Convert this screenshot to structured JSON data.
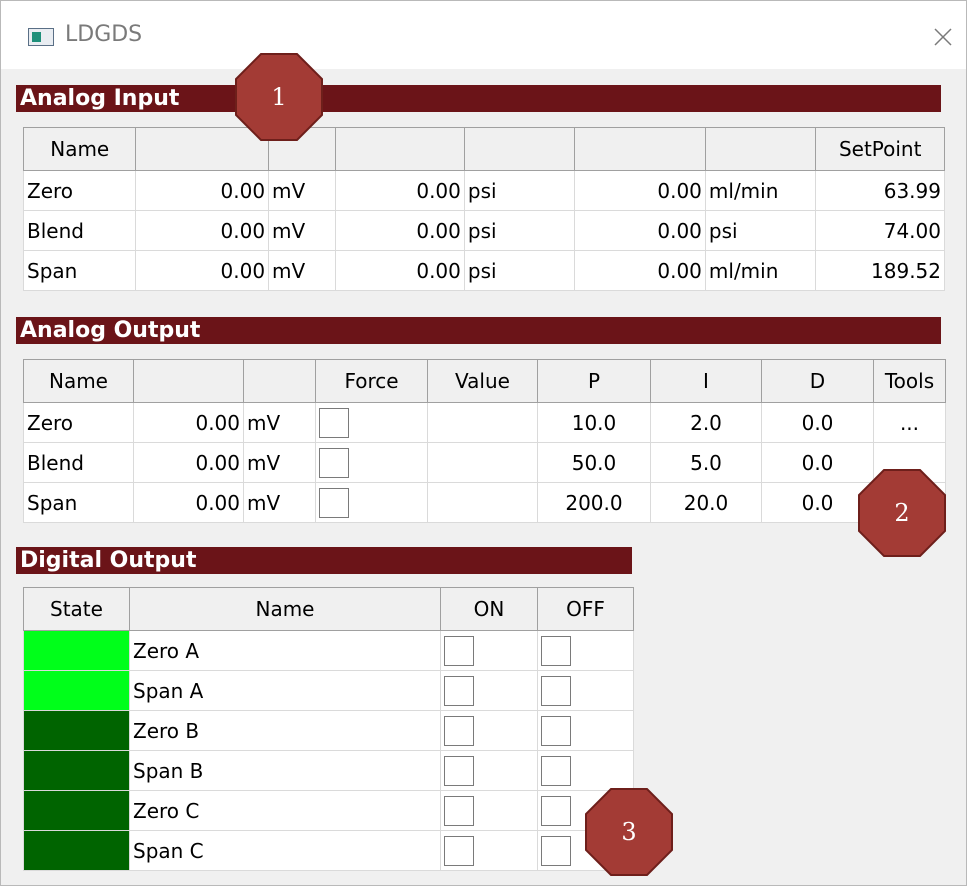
{
  "window": {
    "title": "LDGDS",
    "icon": "app-window-icon",
    "close_icon": "close-icon"
  },
  "analog_input": {
    "title": "Analog Input",
    "headers": [
      "Name",
      "",
      "",
      "",
      "",
      "",
      "",
      "SetPoint"
    ],
    "rows": [
      {
        "name": "Zero",
        "v1": "0.00",
        "u1": "mV",
        "v2": "0.00",
        "u2": "psi",
        "v3": "0.00",
        "u3": "ml/min",
        "setpoint": "63.99"
      },
      {
        "name": "Blend",
        "v1": "0.00",
        "u1": "mV",
        "v2": "0.00",
        "u2": "psi",
        "v3": "0.00",
        "u3": "psi",
        "setpoint": "74.00"
      },
      {
        "name": "Span",
        "v1": "0.00",
        "u1": "mV",
        "v2": "0.00",
        "u2": "psi",
        "v3": "0.00",
        "u3": "ml/min",
        "setpoint": "189.52"
      }
    ]
  },
  "analog_output": {
    "title": "Analog Output",
    "headers": [
      "Name",
      "",
      "",
      "Force",
      "Value",
      "P",
      "I",
      "D",
      "Tools"
    ],
    "rows": [
      {
        "name": "Zero",
        "v": "0.00",
        "unit": "mV",
        "value": "",
        "p": "10.0",
        "i": "2.0",
        "d": "0.0",
        "tools": "..."
      },
      {
        "name": "Blend",
        "v": "0.00",
        "unit": "mV",
        "value": "",
        "p": "50.0",
        "i": "5.0",
        "d": "0.0",
        "tools": ""
      },
      {
        "name": "Span",
        "v": "0.00",
        "unit": "mV",
        "value": "",
        "p": "200.0",
        "i": "20.0",
        "d": "0.0",
        "tools": ""
      }
    ]
  },
  "digital_output": {
    "title": "Digital Output",
    "headers": [
      "State",
      "Name",
      "ON",
      "OFF"
    ],
    "rows": [
      {
        "name": "Zero A",
        "state": "on"
      },
      {
        "name": "Span A",
        "state": "on"
      },
      {
        "name": "Zero B",
        "state": "off"
      },
      {
        "name": "Span B",
        "state": "off"
      },
      {
        "name": "Zero C",
        "state": "off"
      },
      {
        "name": "Span C",
        "state": "off"
      }
    ]
  },
  "colors": {
    "section_header": "#6b1418",
    "state_on": "#00ff1a",
    "state_off": "#006400",
    "marker_fill": "#a33b35"
  },
  "markers": [
    "1",
    "2",
    "3"
  ]
}
